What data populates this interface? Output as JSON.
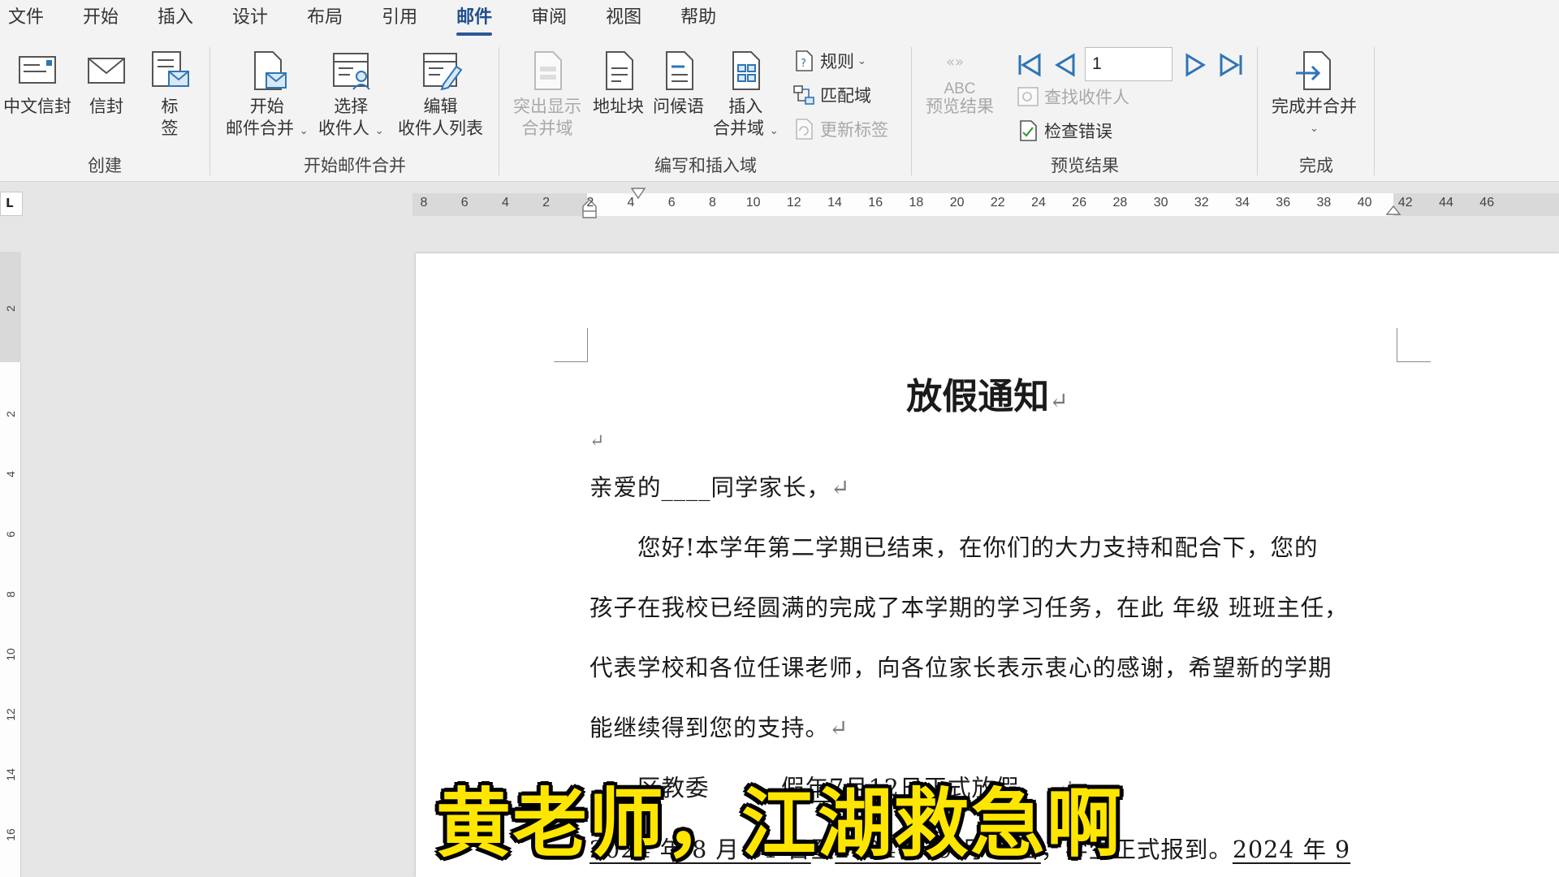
{
  "menu": {
    "items": [
      {
        "label": "文件"
      },
      {
        "label": "开始"
      },
      {
        "label": "插入"
      },
      {
        "label": "设计"
      },
      {
        "label": "布局"
      },
      {
        "label": "引用"
      },
      {
        "label": "邮件"
      },
      {
        "label": "审阅"
      },
      {
        "label": "视图"
      },
      {
        "label": "帮助"
      }
    ],
    "active": "邮件"
  },
  "ribbon": {
    "create": {
      "label": "创建",
      "chinese_envelope": "中文信封",
      "envelope": "信封",
      "labels_line1": "标",
      "labels_line2": "签"
    },
    "start_merge": {
      "label": "开始邮件合并",
      "start_line1": "开始",
      "start_line2": "邮件合并",
      "select_line1": "选择",
      "select_line2": "收件人",
      "edit_line1": "编辑",
      "edit_line2": "收件人列表"
    },
    "write_insert": {
      "label": "编写和插入域",
      "highlight_line1": "突出显示",
      "highlight_line2": "合并域",
      "address_block": "地址块",
      "greeting_line": "问候语",
      "insert_line1": "插入",
      "insert_line2": "合并域",
      "rules": "规则",
      "match_fields": "匹配域",
      "update_labels": "更新标签"
    },
    "preview": {
      "label": "预览结果",
      "preview_results": "预览结果",
      "abc": "ABC",
      "record_number": "1",
      "find_recipient": "查找收件人",
      "check_errors": "检查错误"
    },
    "finish": {
      "label": "完成",
      "finish_merge": "完成并合并"
    }
  },
  "ruler": {
    "corner": "L",
    "horizontal_ticks": [
      "8",
      "6",
      "4",
      "2",
      "2",
      "4",
      "6",
      "8",
      "10",
      "12",
      "14",
      "16",
      "18",
      "20",
      "22",
      "24",
      "26",
      "28",
      "30",
      "32",
      "34",
      "36",
      "38",
      "40",
      "42",
      "44",
      "46"
    ],
    "vertical_ticks": [
      "2",
      "2",
      "4",
      "6",
      "8",
      "10",
      "12",
      "14",
      "16"
    ]
  },
  "document": {
    "title": "放假通知",
    "para_mark": "↵",
    "lines": [
      "亲爱的____同学家长，",
      "　　您好!本学年第二学期已结束，在你们的大力支持和配合下，您的",
      "孩子在我校已经圆满的完成了本学期的学习任务，在此 年级 班班主任，",
      "代表学校和各位任课老师，向各位家长表示衷心的感谢，希望新的学期",
      "能继续得到您的支持。"
    ],
    "line6_prefix": "　　区教委",
    "line6_gap": "　　　假",
    "line6_underlined": "年7月12日",
    "line6_suffix": "正式放假，",
    "line7_part1": "2024 年 8 月 31 日",
    "line7_mid": "至",
    "line7_part2": "2024 年 9 月 1 日",
    "line7_mid2": "，学生正式报到。",
    "line7_part3": "2024 年 9"
  },
  "subtitle": "黄老师，江湖救急啊",
  "colors": {
    "accent": "#2b5797",
    "subtitle_fill": "#ffe600",
    "ribbon_bg": "#f3f3f3",
    "icon_blue": "#2e75b6"
  }
}
